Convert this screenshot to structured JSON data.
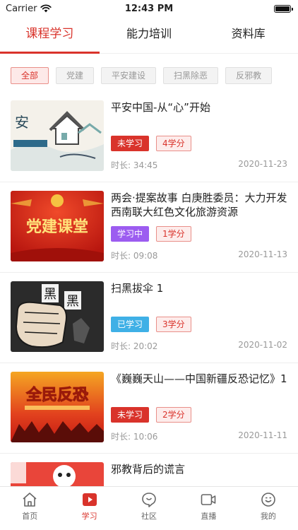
{
  "status": {
    "carrier": "Carrier",
    "time": "12:43 PM"
  },
  "top_tabs": [
    {
      "label": "课程学习",
      "active": true
    },
    {
      "label": "能力培训",
      "active": false
    },
    {
      "label": "资料库",
      "active": false
    }
  ],
  "filters": [
    {
      "label": "全部",
      "active": true
    },
    {
      "label": "党建",
      "active": false
    },
    {
      "label": "平安建设",
      "active": false
    },
    {
      "label": "扫黑除恶",
      "active": false
    },
    {
      "label": "反邪教",
      "active": false
    }
  ],
  "courses": [
    {
      "title": "平安中国-从“心”开始",
      "status": "未学习",
      "status_color": "#d9332b",
      "credit": "4学分",
      "duration": "时长: 34:45",
      "date": "2020-11-23",
      "thumb_icon": "ink-landscape-image",
      "thumb_text": "安"
    },
    {
      "title": "两会·提案故事 白庚胜委员：大力开发西南联大红色文化旅游资源",
      "status": "学习中",
      "status_color": "#9c5cf0",
      "credit": "1学分",
      "duration": "时长: 09:08",
      "date": "2020-11-13",
      "thumb_icon": "party-building-banner-image",
      "thumb_text": "党建课堂"
    },
    {
      "title": "扫黑拔伞 1",
      "status": "已学习",
      "status_color": "#3fb0e6",
      "credit": "3学分",
      "duration": "时长: 20:02",
      "date": "2020-11-02",
      "thumb_icon": "fist-crush-image",
      "thumb_text": "黑"
    },
    {
      "title": "《巍巍天山——中国新疆反恐记忆》1",
      "status": "未学习",
      "status_color": "#d9332b",
      "credit": "2学分",
      "duration": "时长: 10:06",
      "date": "2020-11-11",
      "thumb_icon": "anti-terror-poster-image",
      "thumb_text": "全民反恐"
    },
    {
      "title": "邪教背后的谎言",
      "status": "",
      "status_color": "#d9332b",
      "credit": "",
      "duration": "",
      "date": "",
      "thumb_icon": "cartoon-poster-image",
      "thumb_text": ""
    }
  ],
  "bottom_nav": [
    {
      "label": "首页",
      "icon": "home-icon",
      "active": false
    },
    {
      "label": "学习",
      "icon": "play-icon",
      "active": true
    },
    {
      "label": "社区",
      "icon": "chat-bubble-icon",
      "active": false
    },
    {
      "label": "直播",
      "icon": "video-camera-icon",
      "active": false
    },
    {
      "label": "我的",
      "icon": "smiley-icon",
      "active": false
    }
  ],
  "colors": {
    "accent": "#d9332b"
  }
}
